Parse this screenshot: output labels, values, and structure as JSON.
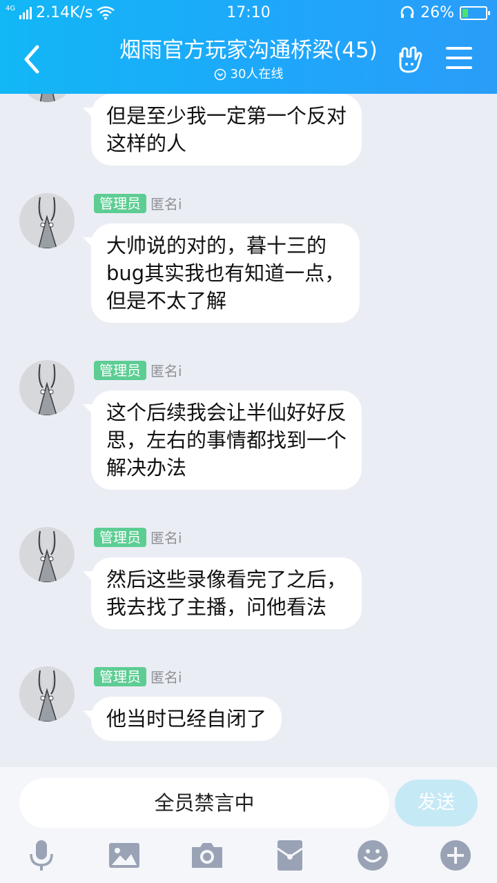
{
  "status_bar": {
    "network": "4G",
    "speed": "2.14K/s",
    "time": "17:10",
    "battery": "26%",
    "battery_level": 0.26
  },
  "header": {
    "title": "烟雨官方玩家沟通桥梁(45)",
    "online": "30人在线"
  },
  "messages": [
    {
      "badge": "",
      "nick": "",
      "text": "但是至少我一定第一个反对\n这样的人"
    },
    {
      "badge": "管理员",
      "nick": "匿名i",
      "text": "大帅说的对的，暮十三的\nbug其实我也有知道一点，\n但是不太了解"
    },
    {
      "badge": "管理员",
      "nick": "匿名i",
      "text": "这个后续我会让半仙好好反\n思，左右的事情都找到一个\n解决办法"
    },
    {
      "badge": "管理员",
      "nick": "匿名i",
      "text": "然后这些录像看完了之后，\n我去找了主播，问他看法"
    },
    {
      "badge": "管理员",
      "nick": "匿名i",
      "text": "他当时已经自闭了"
    }
  ],
  "input": {
    "muted_text": "全员禁言中",
    "send_label": "发送"
  },
  "toolbar": {
    "icons": [
      "microphone-icon",
      "image-icon",
      "camera-icon",
      "red-packet-icon",
      "emoji-icon",
      "plus-icon"
    ]
  },
  "colors": {
    "header": "#12b7f5",
    "badge": "#5dcd93",
    "send_disabled": "#c6e9f6",
    "tool_icon": "#9aa3b5"
  }
}
